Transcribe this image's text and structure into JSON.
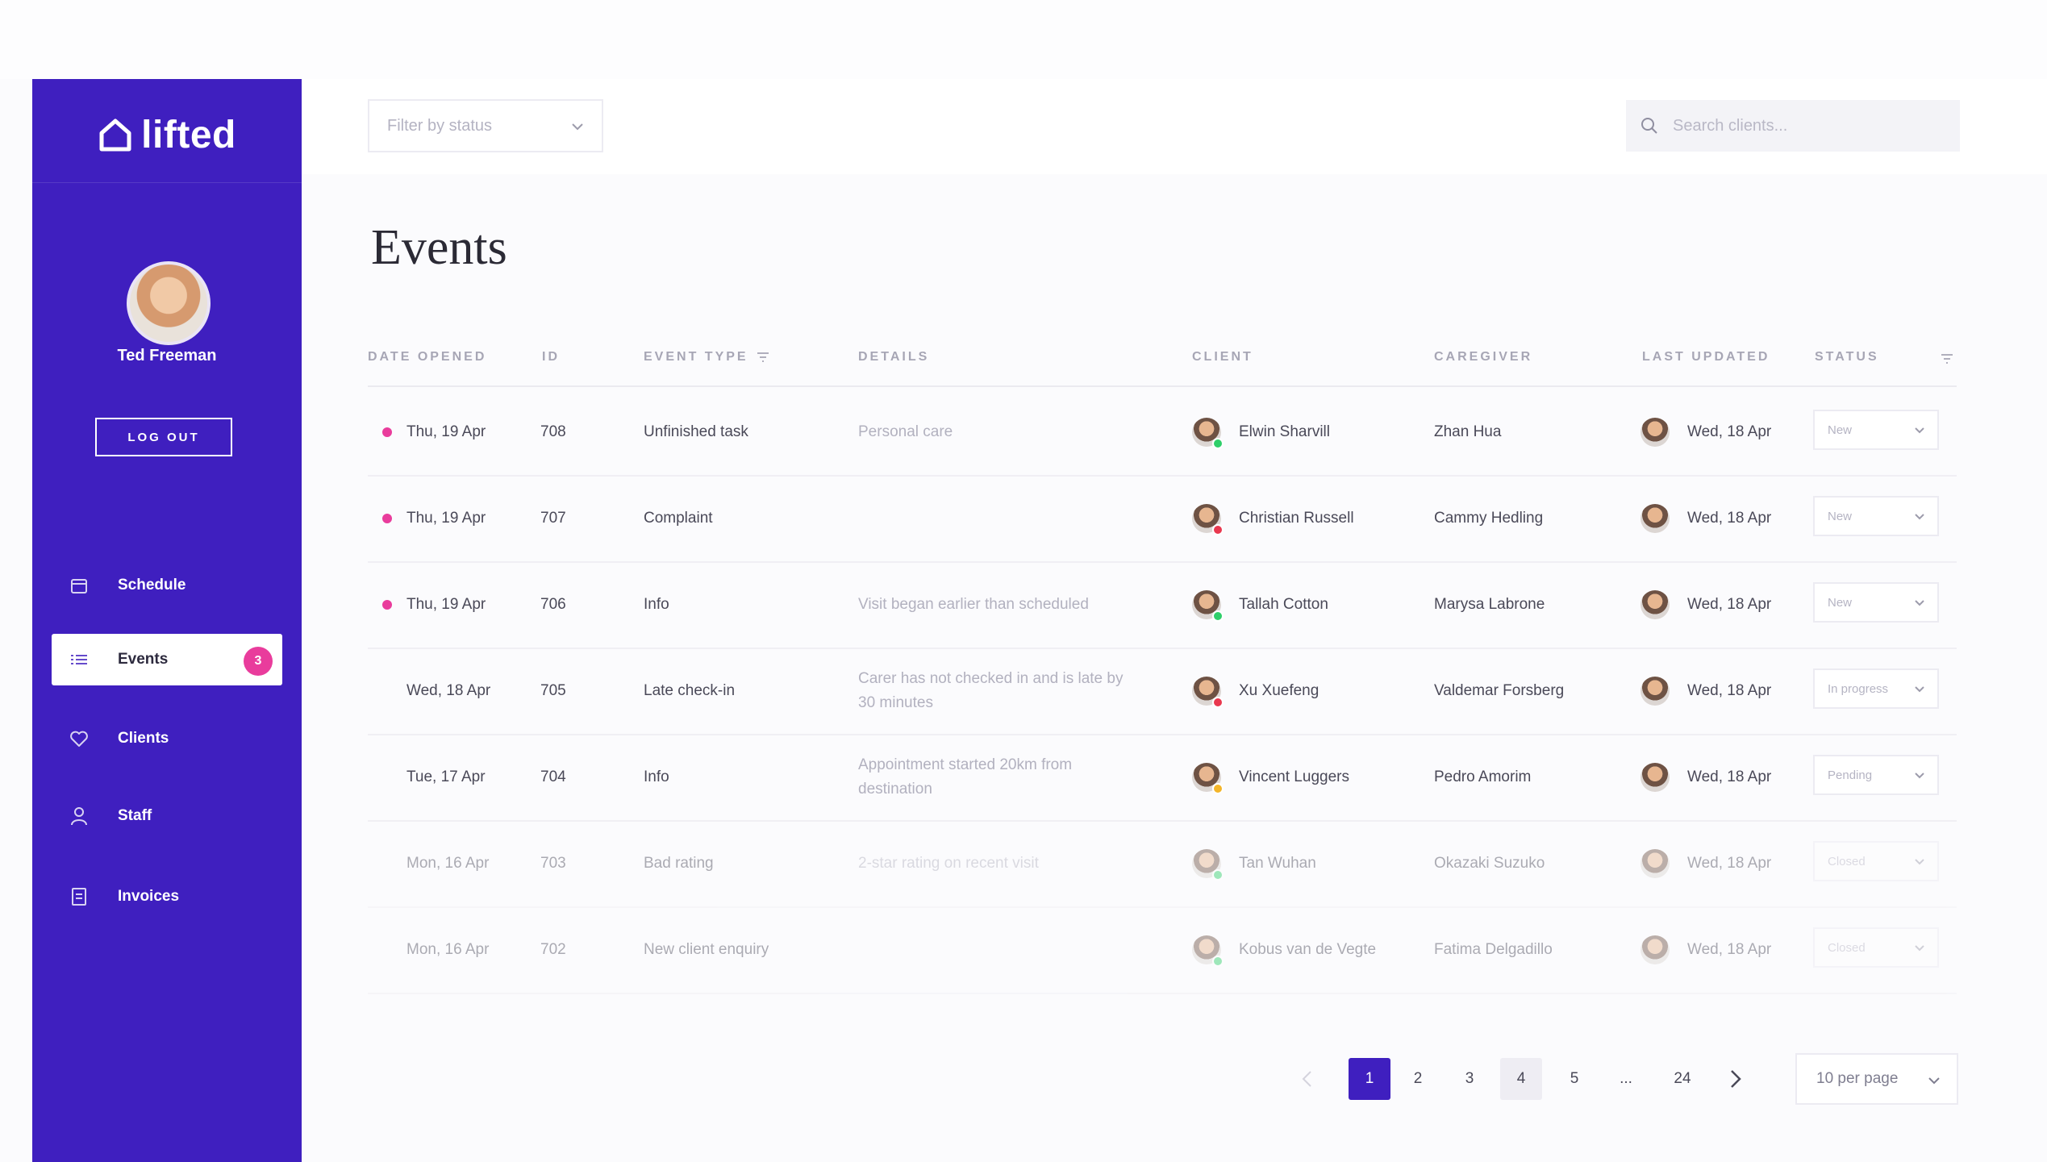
{
  "app": {
    "logo_text": "lifted"
  },
  "user": {
    "name": "Ted Freeman",
    "logout_label": "LOG OUT"
  },
  "nav": [
    {
      "label": "Schedule",
      "icon": "calendar-icon"
    },
    {
      "label": "Events",
      "icon": "list-icon",
      "active": true,
      "badge": "3"
    },
    {
      "label": "Clients",
      "icon": "heart-icon"
    },
    {
      "label": "Staff",
      "icon": "person-icon"
    },
    {
      "label": "Invoices",
      "icon": "invoice-icon"
    }
  ],
  "toolbar": {
    "filter_placeholder": "Filter by status",
    "search_placeholder": "Search clients..."
  },
  "page": {
    "title": "Events"
  },
  "table": {
    "headers": {
      "date": "DATE OPENED",
      "id": "ID",
      "event_type": "EVENT TYPE",
      "details": "DETAILS",
      "client": "CLIENT",
      "caregiver": "CAREGIVER",
      "last_updated": "LAST UPDATED",
      "status": "STATUS"
    },
    "rows": [
      {
        "date": "Thu, 19 Apr",
        "id": "708",
        "type": "Unfinished task",
        "details": "Personal care",
        "client": "Elwin Sharvill",
        "client_status_color": "#2fcf6a",
        "caregiver": "Zhan Hua",
        "updated": "Wed, 18 Apr",
        "status": "New",
        "unread": true
      },
      {
        "date": "Thu, 19 Apr",
        "id": "707",
        "type": "Complaint",
        "details": "",
        "client": "Christian Russell",
        "client_status_color": "#e9384f",
        "caregiver": "Cammy Hedling",
        "updated": "Wed, 18 Apr",
        "status": "New",
        "unread": true
      },
      {
        "date": "Thu, 19 Apr",
        "id": "706",
        "type": "Info",
        "details": "Visit began earlier than scheduled",
        "client": "Tallah Cotton",
        "client_status_color": "#2fcf6a",
        "caregiver": "Marysa Labrone",
        "updated": "Wed, 18 Apr",
        "status": "New",
        "unread": true
      },
      {
        "date": "Wed, 18 Apr",
        "id": "705",
        "type": "Late check-in",
        "details": "Carer has not checked in and is late by 30 minutes",
        "client": "Xu Xuefeng",
        "client_status_color": "#e9384f",
        "caregiver": "Valdemar Forsberg",
        "updated": "Wed, 18 Apr",
        "status": "In progress",
        "unread": false
      },
      {
        "date": "Tue, 17 Apr",
        "id": "704",
        "type": "Info",
        "details": "Appointment started 20km from destination",
        "client": "Vincent Luggers",
        "client_status_color": "#f3b52a",
        "caregiver": "Pedro Amorim",
        "updated": "Wed, 18 Apr",
        "status": "Pending",
        "unread": false
      },
      {
        "date": "Mon, 16 Apr",
        "id": "703",
        "type": "Bad rating",
        "details": "2-star rating on recent visit",
        "client": "Tan Wuhan",
        "client_status_color": "#2fcf6a",
        "caregiver": "Okazaki Suzuko",
        "updated": "Wed, 18 Apr",
        "status": "Closed",
        "unread": false,
        "faded": true
      },
      {
        "date": "Mon, 16 Apr",
        "id": "702",
        "type": "New client enquiry",
        "details": "",
        "client": "Kobus van de Vegte",
        "client_status_color": "#2fcf6a",
        "caregiver": "Fatima Delgadillo",
        "updated": "Wed, 18 Apr",
        "status": "Closed",
        "unread": false,
        "faded": true
      }
    ]
  },
  "pagination": {
    "pages": [
      "1",
      "2",
      "3",
      "4",
      "5",
      "...",
      "24"
    ],
    "current": "1",
    "per_page_label": "10 per page"
  },
  "colors": {
    "brand": "#3f1fbf",
    "accent": "#e93c9c"
  }
}
